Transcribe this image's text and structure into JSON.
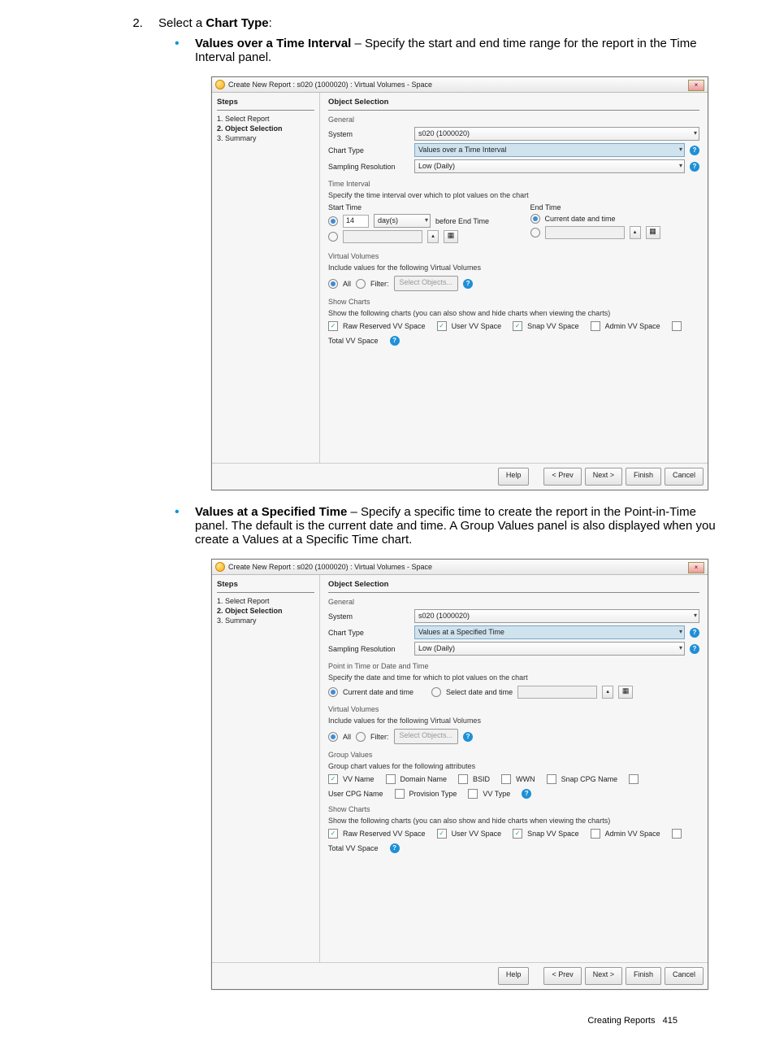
{
  "step2": {
    "num": "2.",
    "text_a": "Select a",
    "text_b": "Chart Type",
    "text_c": ":"
  },
  "bullets": [
    {
      "title": "Values over a Time Interval",
      "desc": " – Specify the start and end time range for the report in the Time Interval panel."
    },
    {
      "title": "Values at a Specified Time",
      "desc": " – Specify a specific time to create the report in the Point-in-Time panel. The default is the current date and time. A Group Values panel is also displayed when you create a Values at a Specific Time chart."
    }
  ],
  "dlg": {
    "title": "Create New Report : s020 (1000020) : Virtual Volumes - Space",
    "steps_hdr": "Steps",
    "content_hdr": "Object Selection",
    "steps": [
      "Select Report",
      "Object Selection",
      "Summary"
    ],
    "general": "General",
    "system_lbl": "System",
    "system_val": "s020 (1000020)",
    "chart_lbl": "Chart Type",
    "chart_vals": {
      "interval": "Values over a Time Interval",
      "specified": "Values at a Specified Time"
    },
    "sampling_lbl": "Sampling Resolution",
    "sampling_val": "Low (Daily)",
    "time_interval_title": "Time Interval",
    "time_interval_desc": "Specify the time interval over which to plot values on the chart",
    "start": "Start Time",
    "end": "End Time",
    "before_end": "before End Time",
    "days": "day(s)",
    "val14": "14",
    "current": "Current date and time",
    "pit_title": "Point in Time or Date and Time",
    "pit_desc": "Specify the date and time for which to plot values on the chart",
    "pit_select": "Select date and time",
    "vv_title": "Virtual Volumes",
    "vv_desc": "Include values for the following Virtual Volumes",
    "all": "All",
    "filter": "Filter:",
    "selobj": "Select Objects...",
    "grp_title": "Group Values",
    "grp_desc": "Group chart values for the following attributes",
    "grp_names": [
      "VV Name",
      "Domain Name",
      "BSID",
      "WWN",
      "Snap CPG Name",
      "User CPG Name",
      "Provision Type",
      "VV Type"
    ],
    "grp_checked": [
      true,
      false,
      false,
      false,
      false,
      false,
      false,
      false
    ],
    "show_title": "Show Charts",
    "show_desc": "Show the following charts (you can also show and hide charts when viewing the charts)",
    "show_names": [
      "Raw Reserved VV Space",
      "User VV Space",
      "Snap VV Space",
      "Admin VV Space",
      "Total VV Space"
    ],
    "show_checked": [
      true,
      true,
      true,
      false,
      false
    ],
    "buttons": {
      "help": "Help",
      "prev": "< Prev",
      "next": "Next >",
      "finish": "Finish",
      "cancel": "Cancel"
    }
  },
  "footer": {
    "label": "Creating Reports",
    "page": "415"
  }
}
